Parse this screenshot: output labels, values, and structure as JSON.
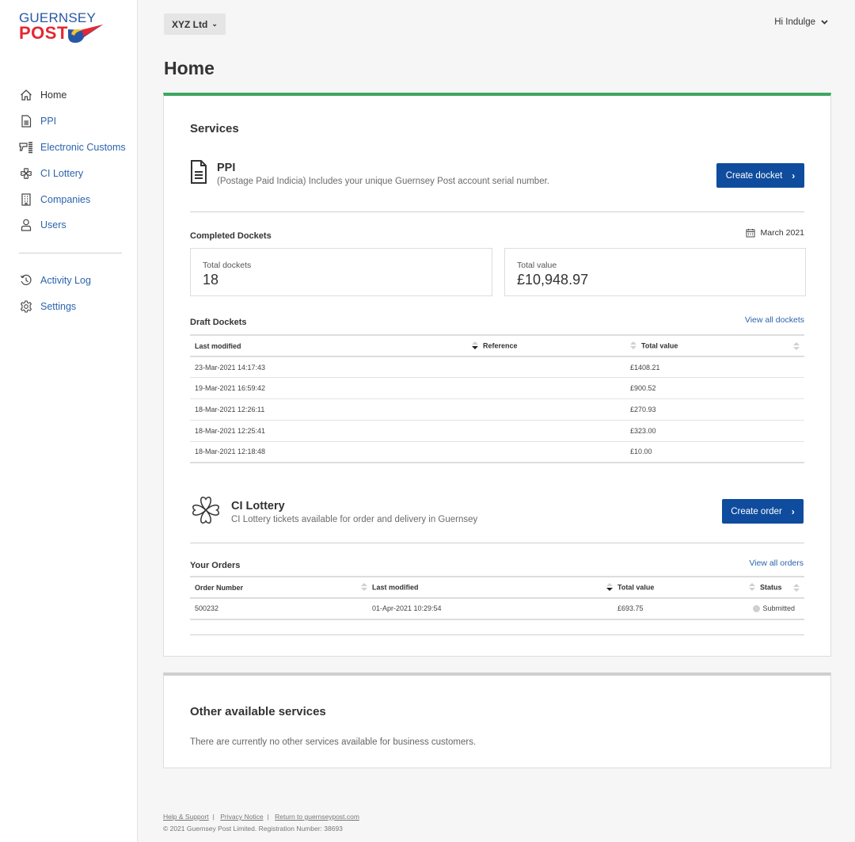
{
  "brand": {
    "line1": "GUERNSEY",
    "line2": "POST"
  },
  "colors": {
    "accent_green": "#3ea760",
    "primary_blue": "#0f4c9e",
    "link_blue": "#2d63ad"
  },
  "sidebar": {
    "items": [
      {
        "label": "Home",
        "icon": "home-icon"
      },
      {
        "label": "PPI",
        "icon": "document-icon"
      },
      {
        "label": "Electronic Customs",
        "icon": "scanner-icon"
      },
      {
        "label": "CI Lottery",
        "icon": "clover-icon"
      },
      {
        "label": "Companies",
        "icon": "building-icon"
      },
      {
        "label": "Users",
        "icon": "user-icon"
      }
    ],
    "secondary": [
      {
        "label": "Activity Log",
        "icon": "history-icon"
      },
      {
        "label": "Settings",
        "icon": "gear-icon"
      }
    ]
  },
  "header": {
    "company": "XYZ Ltd",
    "greeting": "Hi Indulge",
    "title": "Home"
  },
  "services": {
    "heading": "Services",
    "ppi": {
      "title": "PPI",
      "description": "(Postage Paid Indicia) Includes your unique Guernsey Post account serial number.",
      "button": "Create docket",
      "completed": {
        "heading": "Completed Dockets",
        "period": "March 2021",
        "total_dockets_label": "Total dockets",
        "total_dockets": "18",
        "total_value_label": "Total value",
        "total_value": "£10,948.97"
      },
      "drafts": {
        "heading": "Draft Dockets",
        "view_all": "View all dockets",
        "columns": [
          "Last modified",
          "Reference",
          "Total value"
        ],
        "rows": [
          {
            "last_modified": "23-Mar-2021 14:17:43",
            "reference": "",
            "total_value": "£1408.21"
          },
          {
            "last_modified": "19-Mar-2021 16:59:42",
            "reference": "",
            "total_value": "£900.52"
          },
          {
            "last_modified": "18-Mar-2021 12:26:11",
            "reference": "",
            "total_value": "£270.93"
          },
          {
            "last_modified": "18-Mar-2021 12:25:41",
            "reference": "",
            "total_value": "£323.00"
          },
          {
            "last_modified": "18-Mar-2021 12:18:48",
            "reference": "",
            "total_value": "£10.00"
          }
        ]
      }
    },
    "lottery": {
      "title": "CI Lottery",
      "description": "CI Lottery tickets available for order and delivery in Guernsey",
      "button": "Create order",
      "orders": {
        "heading": "Your Orders",
        "view_all": "View all orders",
        "columns": [
          "Order Number",
          "Last modified",
          "Total value",
          "Status"
        ],
        "rows": [
          {
            "order_number": "500232",
            "last_modified": "01-Apr-2021 10:29:54",
            "total_value": "£693.75",
            "status": "Submitted"
          }
        ]
      }
    }
  },
  "other_services": {
    "heading": "Other available services",
    "description": "There are currently no other services available for business customers."
  },
  "footer": {
    "links": [
      "Help & Support",
      "Privacy Notice",
      "Return to guernseypost.com"
    ],
    "copyright": "© 2021 Guernsey Post Limited. Registration Number: 38693"
  }
}
